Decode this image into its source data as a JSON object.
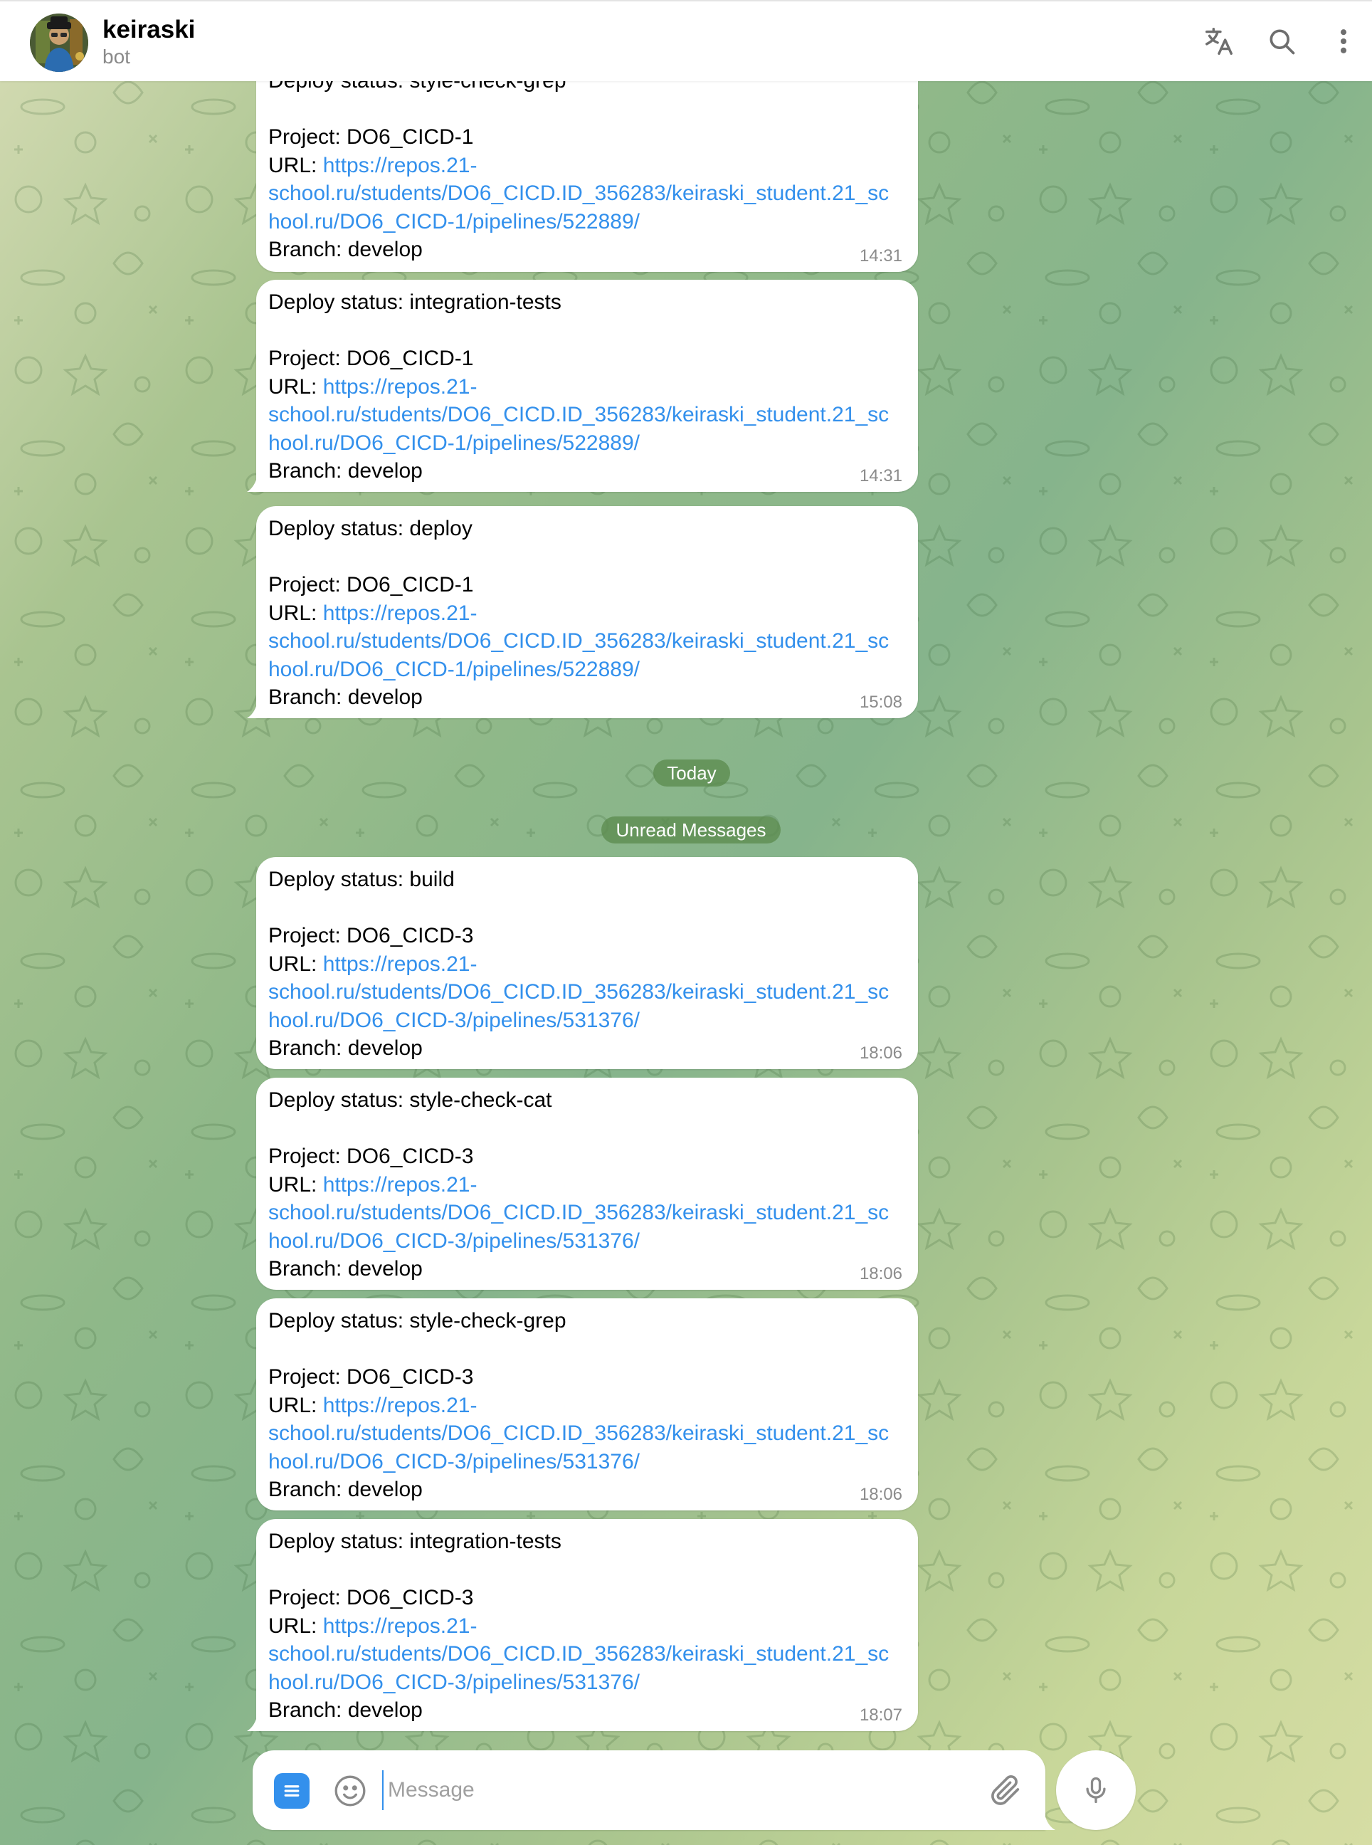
{
  "header": {
    "name": "keiraski",
    "status": "bot"
  },
  "icons": {
    "translate": "translate-icon",
    "search": "search-icon",
    "more": "more-vertical-icon",
    "menu": "bot-menu-icon",
    "emoji": "emoji-icon",
    "attach": "paperclip-icon",
    "mic": "microphone-icon"
  },
  "colors": {
    "accent": "#3390ec",
    "pill": "#5c8c50",
    "bubble": "#ffffff"
  },
  "messages": [
    {
      "status_line": "Deploy status: style-check-grep",
      "project_line": "Project: DO6_CICD-1",
      "url_prefix": "URL: ",
      "url_l1": "https://repos.21-",
      "url_l2": "school.ru/students/DO6_CICD.ID_356283/keiraski_student.21_sc",
      "url_l3": "hool.ru/DO6_CICD-1/pipelines/522889/",
      "branch_line": "Branch: develop",
      "time": "14:31"
    },
    {
      "status_line": "Deploy status: integration-tests",
      "project_line": "Project: DO6_CICD-1",
      "url_prefix": "URL: ",
      "url_l1": "https://repos.21-",
      "url_l2": "school.ru/students/DO6_CICD.ID_356283/keiraski_student.21_sc",
      "url_l3": "hool.ru/DO6_CICD-1/pipelines/522889/",
      "branch_line": "Branch: develop",
      "time": "14:31"
    },
    {
      "status_line": "Deploy status: deploy",
      "project_line": "Project: DO6_CICD-1",
      "url_prefix": "URL: ",
      "url_l1": "https://repos.21-",
      "url_l2": "school.ru/students/DO6_CICD.ID_356283/keiraski_student.21_sc",
      "url_l3": "hool.ru/DO6_CICD-1/pipelines/522889/",
      "branch_line": "Branch: develop",
      "time": "15:08"
    },
    {
      "status_line": "Deploy status: build",
      "project_line": "Project: DO6_CICD-3",
      "url_prefix": "URL: ",
      "url_l1": "https://repos.21-",
      "url_l2": "school.ru/students/DO6_CICD.ID_356283/keiraski_student.21_sc",
      "url_l3": "hool.ru/DO6_CICD-3/pipelines/531376/",
      "branch_line": "Branch: develop",
      "time": "18:06"
    },
    {
      "status_line": "Deploy status: style-check-cat",
      "project_line": "Project: DO6_CICD-3",
      "url_prefix": "URL: ",
      "url_l1": "https://repos.21-",
      "url_l2": "school.ru/students/DO6_CICD.ID_356283/keiraski_student.21_sc",
      "url_l3": "hool.ru/DO6_CICD-3/pipelines/531376/",
      "branch_line": "Branch: develop",
      "time": "18:06"
    },
    {
      "status_line": "Deploy status: style-check-grep",
      "project_line": "Project: DO6_CICD-3",
      "url_prefix": "URL: ",
      "url_l1": "https://repos.21-",
      "url_l2": "school.ru/students/DO6_CICD.ID_356283/keiraski_student.21_sc",
      "url_l3": "hool.ru/DO6_CICD-3/pipelines/531376/",
      "branch_line": "Branch: develop",
      "time": "18:06"
    },
    {
      "status_line": "Deploy status: integration-tests",
      "project_line": "Project: DO6_CICD-3",
      "url_prefix": "URL: ",
      "url_l1": "https://repos.21-",
      "url_l2": "school.ru/students/DO6_CICD.ID_356283/keiraski_student.21_sc",
      "url_l3": "hool.ru/DO6_CICD-3/pipelines/531376/",
      "branch_line": "Branch: develop",
      "time": "18:07"
    }
  ],
  "separators": {
    "today": "Today",
    "unread": "Unread Messages"
  },
  "composer": {
    "placeholder": "Message"
  }
}
